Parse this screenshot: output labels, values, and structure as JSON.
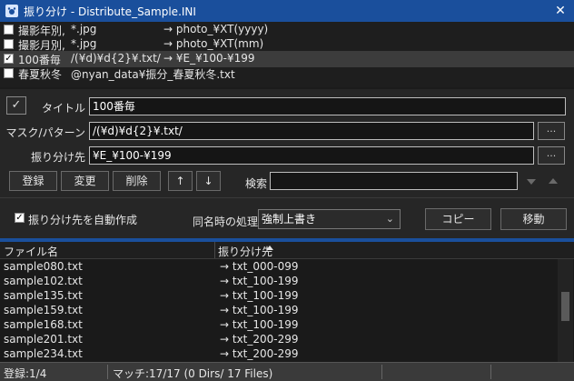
{
  "window": {
    "title": "振り分け - Distribute_Sample.INI"
  },
  "rules": [
    {
      "checked": "",
      "title": "撮影年別,",
      "mask": "*.jpg",
      "dest": "→ photo_¥XT(yyyy)"
    },
    {
      "checked": "",
      "title": "撮影月別,",
      "mask": "*.jpg",
      "dest": "→ photo_¥XT(mm)"
    },
    {
      "checked": "✓",
      "title": "100番毎",
      "mask": "/(¥d)¥d{2}¥.txt/",
      "dest": "→ ¥E_¥100-¥199"
    },
    {
      "checked": "",
      "title": "春夏秋冬",
      "mask": "@nyan_data¥振分_春夏秋冬.txt",
      "dest": ""
    }
  ],
  "form": {
    "enable_check": "✓",
    "title_label": "タイトル",
    "title_value": "100番毎",
    "mask_label": "マスク/パターン",
    "mask_value": "/(¥d)¥d{2}¥.txt/",
    "dest_label": "振り分け先",
    "dest_value": "¥E_¥100-¥199",
    "browse_label": "...",
    "register_label": "登録",
    "change_label": "変更",
    "delete_label": "削除",
    "up_label": "↑",
    "down_label": "↓",
    "search_label": "検索",
    "search_value": "",
    "auto_create_check": "✓",
    "auto_create_label": "振り分け先を自動作成",
    "same_name_label": "同名時の処理",
    "same_name_value": "強制上書き",
    "copy_label": "コピー",
    "move_label": "移動"
  },
  "list": {
    "col_filename": "ファイル名",
    "col_dest": "振り分け先",
    "rows": [
      {
        "file": "sample080.txt",
        "dest": "→ txt_000-099"
      },
      {
        "file": "sample102.txt",
        "dest": "→ txt_100-199"
      },
      {
        "file": "sample135.txt",
        "dest": "→ txt_100-199"
      },
      {
        "file": "sample159.txt",
        "dest": "→ txt_100-199"
      },
      {
        "file": "sample168.txt",
        "dest": "→ txt_100-199"
      },
      {
        "file": "sample201.txt",
        "dest": "→ txt_200-299"
      },
      {
        "file": "sample234.txt",
        "dest": "→ txt_200-299"
      }
    ]
  },
  "status": {
    "registered": "登録:1/4",
    "match": "マッチ:17/17 (0 Dirs/ 17 Files)"
  },
  "colors": {
    "titlebar": "#1a4f9c",
    "background": "#1b1b1b"
  }
}
